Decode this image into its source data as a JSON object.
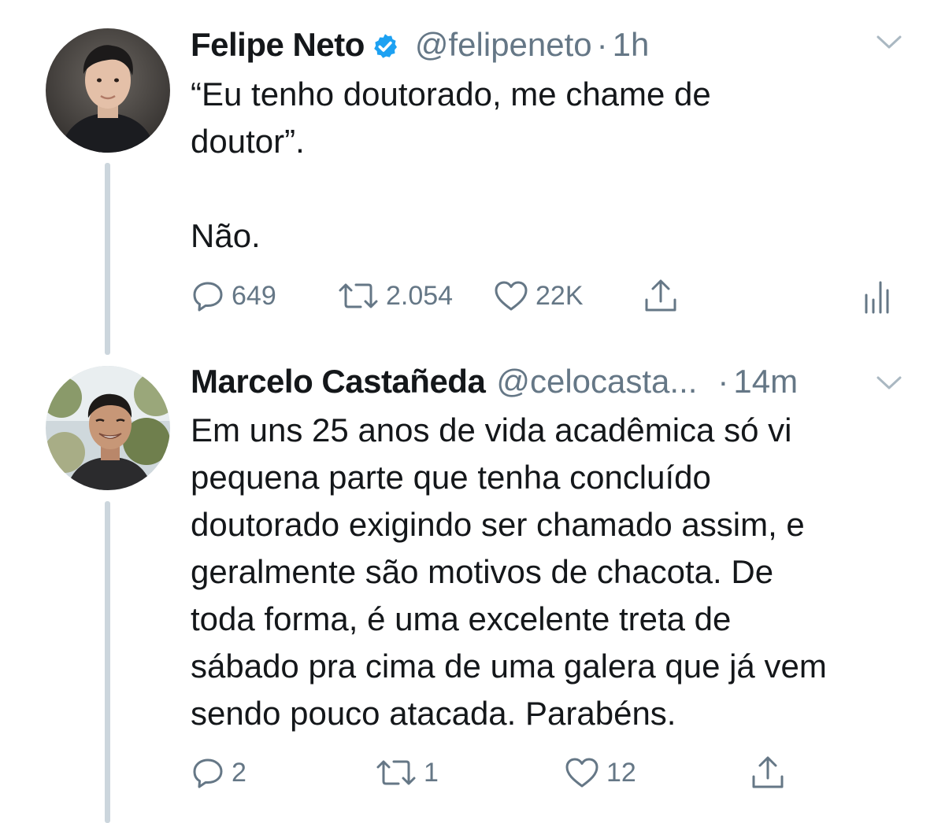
{
  "colors": {
    "text": "#14171a",
    "secondary": "#657786",
    "verified": "#1da1f2",
    "thread_line": "#ccd6dd"
  },
  "tweets": [
    {
      "name": "Felipe Neto",
      "verified": true,
      "handle": "@felipeneto",
      "separator": "·",
      "time": "1h",
      "text_lines": [
        "“Eu tenho doutorado, me chame de",
        "doutor”.",
        "",
        "Não."
      ],
      "actions": {
        "reply_count": "649",
        "retweet_count": "2.054",
        "like_count": "22K"
      },
      "icons": [
        "avatar",
        "verified-badge-icon",
        "chevron-down-icon",
        "reply-icon",
        "retweet-icon",
        "like-icon",
        "share-icon",
        "analytics-icon"
      ]
    },
    {
      "name": "Marcelo Castañeda",
      "verified": false,
      "handle": "@celocasta...",
      "separator": "·",
      "time": "14m",
      "text_lines": [
        "Em uns 25 anos de vida acadêmica só vi",
        "pequena parte que tenha concluído",
        "doutorado exigindo ser chamado assim, e",
        "geralmente são motivos de chacota. De",
        "toda forma, é uma excelente treta de",
        "sábado pra cima de uma galera que já vem",
        "sendo pouco atacada. Parabéns."
      ],
      "actions": {
        "reply_count": "2",
        "retweet_count": "1",
        "like_count": "12"
      },
      "icons": [
        "avatar",
        "chevron-down-icon",
        "reply-icon",
        "retweet-icon",
        "like-icon",
        "share-icon"
      ]
    }
  ]
}
